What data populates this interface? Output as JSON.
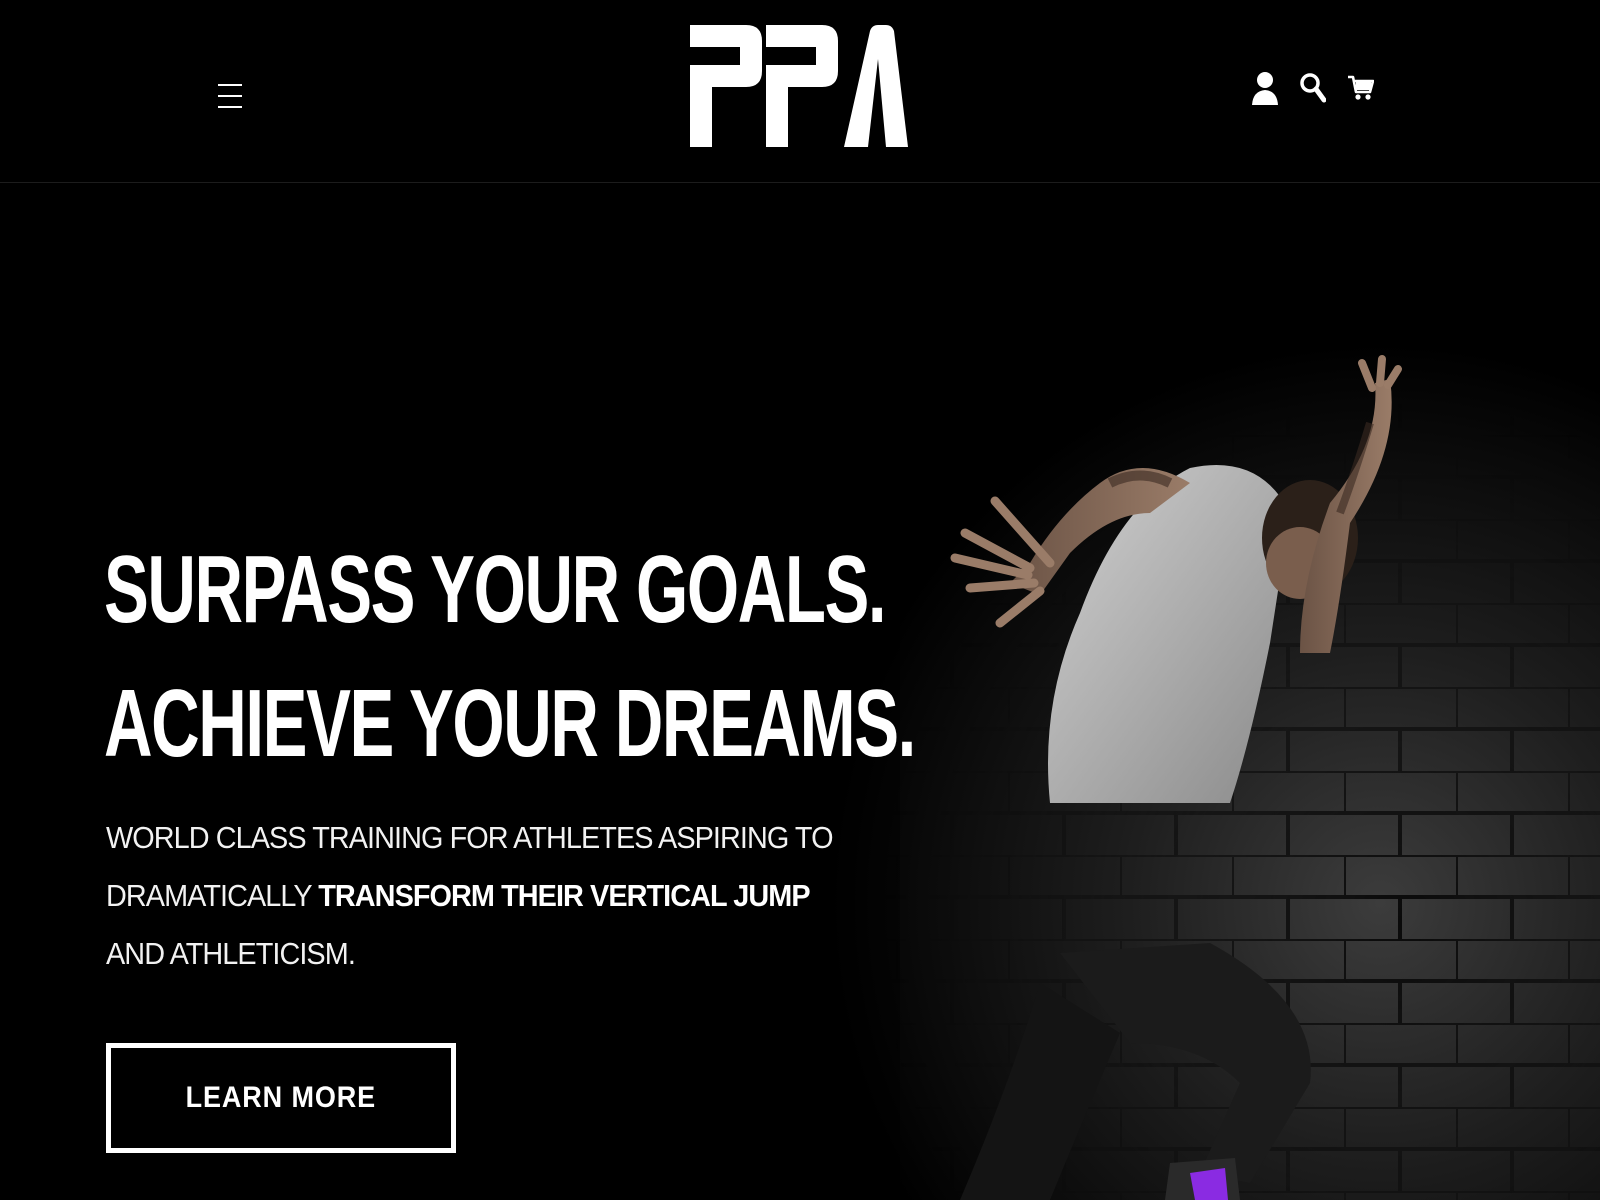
{
  "header": {
    "logo_text": "PPA",
    "menu_icon": "hamburger-menu-icon",
    "icons": [
      "user-icon",
      "search-icon",
      "cart-icon"
    ]
  },
  "hero": {
    "headline_line1": "SURPASS YOUR GOALS.",
    "headline_line2": "ACHIEVE YOUR DREAMS.",
    "sub_line1": "WORLD CLASS TRAINING FOR ATHLETES ASPIRING TO",
    "sub_line2_prefix": "DRAMATICALLY ",
    "sub_line2_bold": "TRANSFORM THEIR VERTICAL JUMP",
    "sub_line3": "AND ATHLETICISM.",
    "cta_label": "LEARN MORE",
    "image_subject": "athlete-sprinting-photo"
  },
  "colors": {
    "background": "#000000",
    "text": "#ffffff",
    "wall": "#2a2a2a",
    "shirt": "#b9b9b9",
    "shoe_accent": "#8a2be2"
  }
}
